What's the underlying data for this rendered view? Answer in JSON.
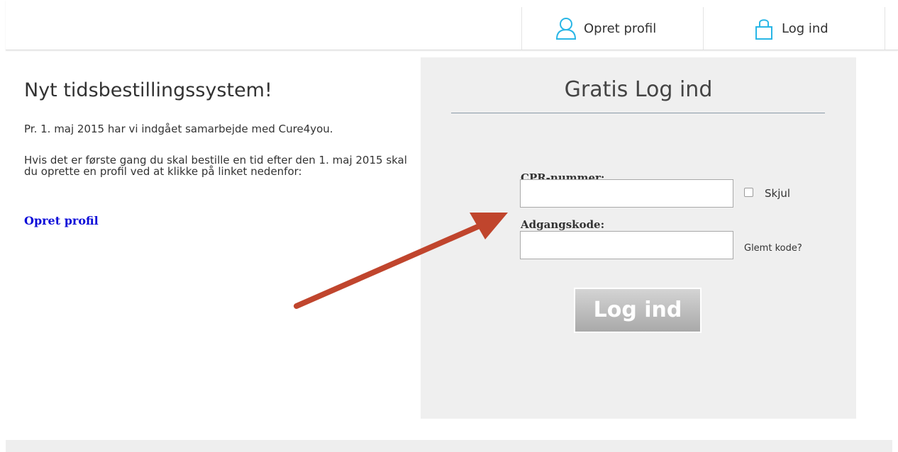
{
  "header": {
    "create_profile_label": "Opret profil",
    "login_label": "Log ind",
    "icons": {
      "create_profile": "user-icon",
      "login": "lock-icon"
    },
    "icon_color": "#29b6e6"
  },
  "main": {
    "title": "Nyt tidsbestillingssystem!",
    "intro": "Pr. 1. maj 2015 har vi indgået samarbejde med Cure4you.",
    "body": "Hvis det er første gang du skal bestille en tid efter den 1. maj 2015 skal du oprette en profil ved at klikke på linket nedenfor:",
    "link_label": "Opret profil"
  },
  "login_panel": {
    "title": "Gratis Log ind",
    "cpr_label": "CPR-nummer:",
    "cpr_value": "",
    "hide_label": "Skjul",
    "hide_checked": false,
    "password_label": "Adgangskode:",
    "password_value": "",
    "forgot_label": "Glemt kode?",
    "submit_label": "Log ind"
  },
  "colors": {
    "link": "#0b0bd8",
    "panel_bg": "#efefef",
    "annotation_arrow": "#c0452d"
  }
}
